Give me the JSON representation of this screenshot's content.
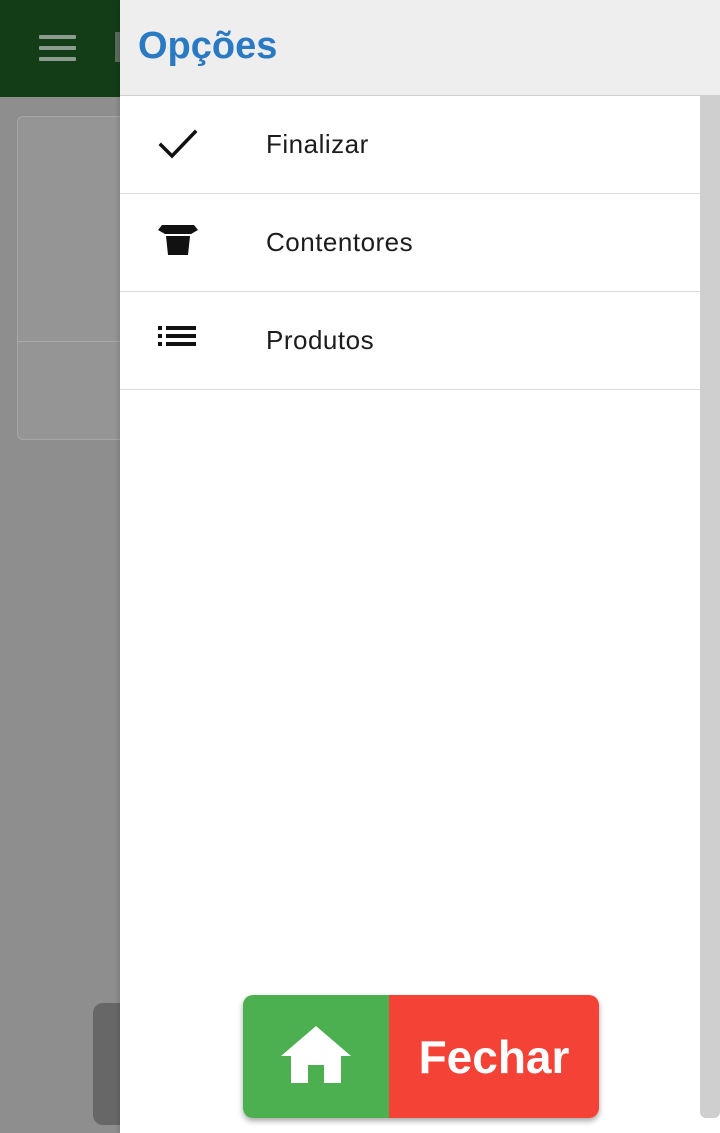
{
  "drawer": {
    "title": "Opções",
    "items": [
      {
        "label": "Finalizar",
        "icon": "check-icon"
      },
      {
        "label": "Contentores",
        "icon": "container-icon"
      },
      {
        "label": "Produtos",
        "icon": "list-icon"
      }
    ]
  },
  "actions": {
    "home_icon": "home-icon",
    "close_label": "Fechar"
  },
  "colors": {
    "app_bar": "#123d17",
    "title_blue": "#2a7ac3",
    "home_green": "#4caf50",
    "close_red": "#f44336"
  }
}
